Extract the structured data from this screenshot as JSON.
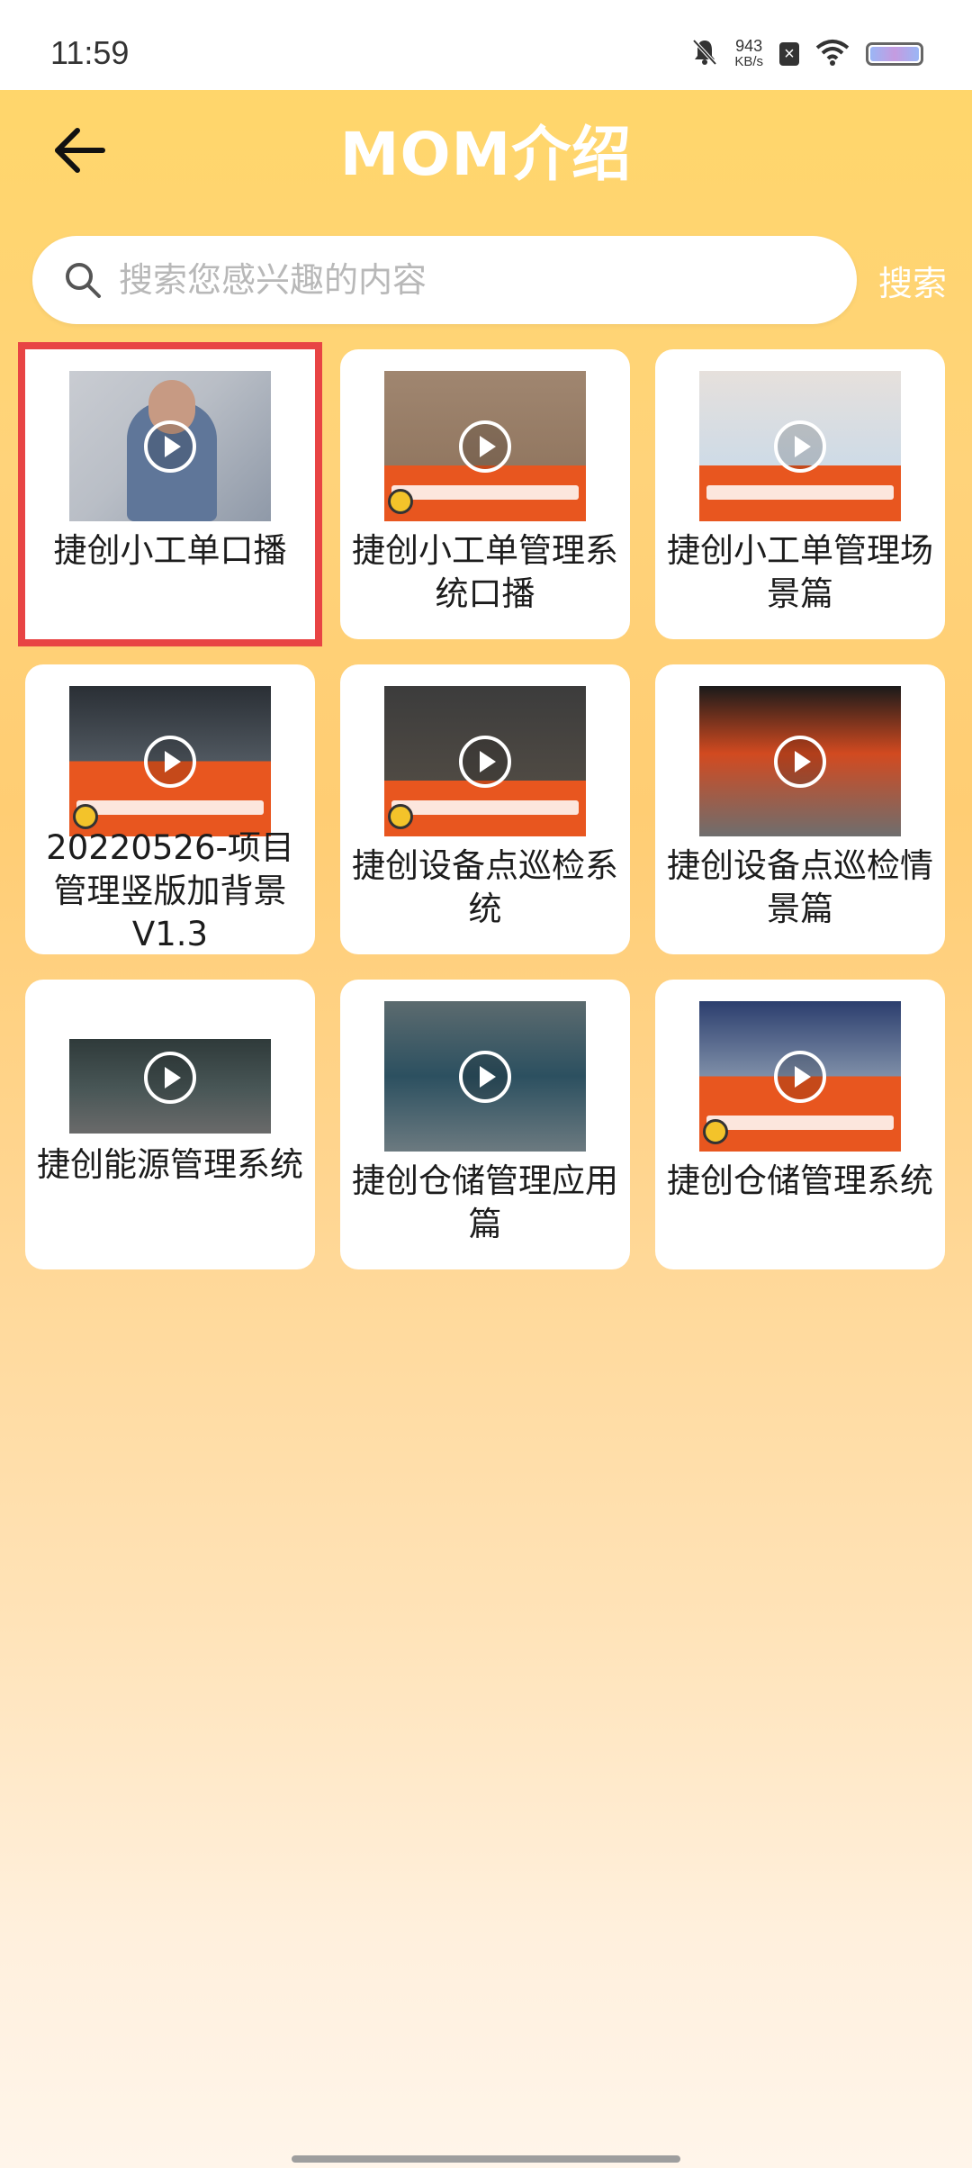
{
  "status_bar": {
    "time": "11:59",
    "net_speed_value": "943",
    "net_speed_unit": "KB/s",
    "icons": [
      "bell-muted-icon",
      "close-box-icon",
      "wifi-icon",
      "battery-icon"
    ]
  },
  "header": {
    "title": "MOM介绍",
    "back_icon": "arrow-left-icon"
  },
  "search": {
    "placeholder": "搜索您感兴趣的内容",
    "value": "",
    "button_label": "搜索",
    "icon": "search-icon"
  },
  "videos": [
    {
      "title": "捷创小工单口播",
      "selected": true
    },
    {
      "title": "捷创小工单管理系统口播",
      "selected": false
    },
    {
      "title": "捷创小工单管理场景篇",
      "selected": false
    },
    {
      "title": "20220526-项目管理竖版加背景V1.3",
      "selected": false
    },
    {
      "title": "捷创设备点巡检系统",
      "selected": false
    },
    {
      "title": "捷创设备点巡检情景篇",
      "selected": false
    },
    {
      "title": "捷创能源管理系统",
      "selected": false
    },
    {
      "title": "捷创仓储管理应用篇",
      "selected": false
    },
    {
      "title": "捷创仓储管理系统",
      "selected": false
    }
  ],
  "colors": {
    "accent_yellow": "#ffd66b",
    "selection_red": "#e84444",
    "banner_orange": "#e8561f"
  }
}
